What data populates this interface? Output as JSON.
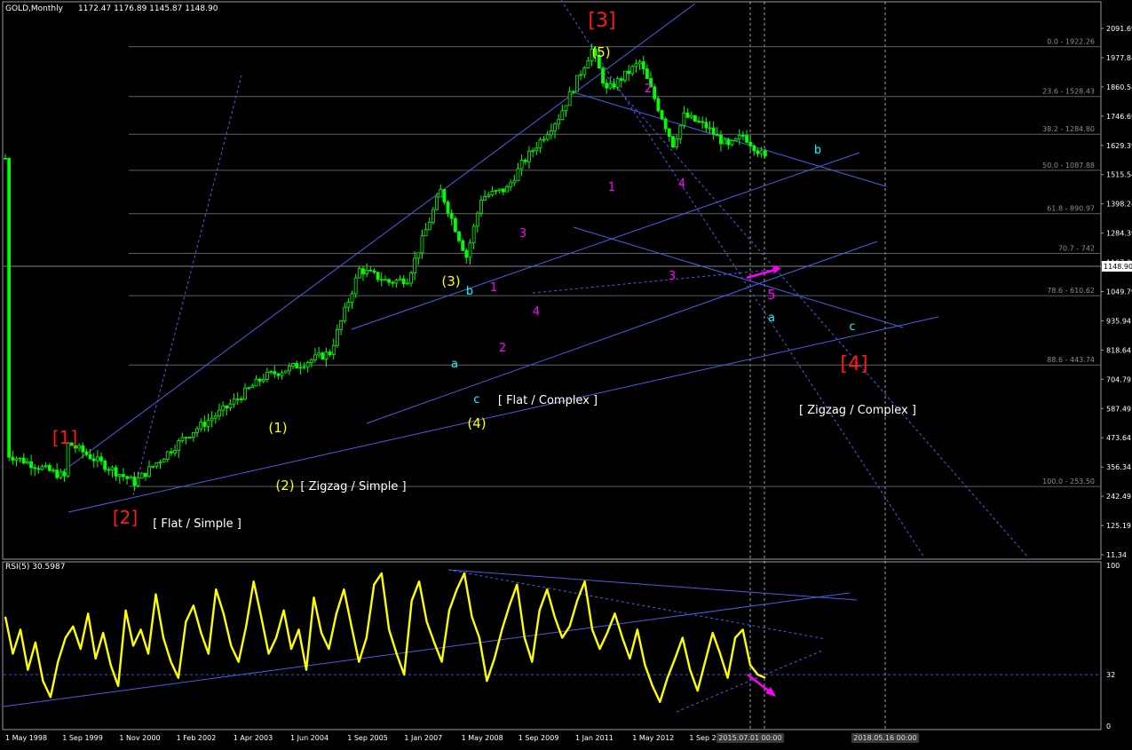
{
  "window": {
    "symbol_title": "GOLD,Monthly",
    "ohlc": "1172.47 1176.89 1145.87 1148.90"
  },
  "colors": {
    "background": "#000000",
    "candles": "#00ff00",
    "trendlines": "#4a5ee8",
    "fib_lines": "#5a6268",
    "rsi_line": "#ffff00",
    "wave_red": "#ff1a1a",
    "wave_yellow": "#ffff00",
    "wave_magenta": "#ff00ff",
    "wave_cyan": "#00ffff",
    "axis_text": "#ffffff"
  },
  "chart_data": [
    {
      "type": "candlestick",
      "title": "GOLD,Monthly",
      "y_scale": "log",
      "ylim": [
        11.34,
        2200
      ],
      "price_axis_ticks": [
        "2091.69",
        "1977.84",
        "1860.54",
        "1746.69",
        "1629.39",
        "1515.54",
        "1398.24",
        "1284.39",
        "1167.09",
        "1049.79",
        "935.94",
        "818.64",
        "704.79",
        "587.49",
        "473.64",
        "356.34",
        "242.49",
        "125.19",
        "11.34"
      ],
      "current_price_label": "1148.90",
      "time_axis_ticks": [
        "1 May 1998",
        "1 Sep 1999",
        "1 Nov 2000",
        "1 Feb 2002",
        "1 Apr 2003",
        "1 Jun 2004",
        "1 Sep 2005",
        "1 Jan 2007",
        "1 May 2008",
        "1 Sep 2009",
        "1 Jan 2011",
        "1 May 2012",
        "1 Sep 20"
      ],
      "time_axis_markers": [
        "2015.07.01 00:00",
        "2018.05.16 00:00"
      ],
      "price_path": [
        {
          "date": "1998.05",
          "price": 295
        },
        {
          "date": "1999.09",
          "price": 265
        },
        {
          "date": "1999.10",
          "price": 310
        },
        {
          "date": "2000.06",
          "price": 285
        },
        {
          "date": "2001.04",
          "price": 258
        },
        {
          "date": "2002.06",
          "price": 320
        },
        {
          "date": "2003.05",
          "price": 365
        },
        {
          "date": "2004.03",
          "price": 420
        },
        {
          "date": "2004.11",
          "price": 440
        },
        {
          "date": "2005.09",
          "price": 470
        },
        {
          "date": "2006.05",
          "price": 690
        },
        {
          "date": "2007.01",
          "price": 650
        },
        {
          "date": "2007.06",
          "price": 660
        },
        {
          "date": "2008.03",
          "price": 990
        },
        {
          "date": "2008.10",
          "price": 730
        },
        {
          "date": "2009.02",
          "price": 960
        },
        {
          "date": "2009.09",
          "price": 1000
        },
        {
          "date": "2010.01",
          "price": 1120
        },
        {
          "date": "2010.06",
          "price": 1250
        },
        {
          "date": "2010.11",
          "price": 1390
        },
        {
          "date": "2011.08",
          "price": 1900
        },
        {
          "date": "2011.12",
          "price": 1570
        },
        {
          "date": "2012.09",
          "price": 1790
        },
        {
          "date": "2013.06",
          "price": 1225
        },
        {
          "date": "2013.09",
          "price": 1400
        },
        {
          "date": "2014.03",
          "price": 1330
        },
        {
          "date": "2014.09",
          "price": 1210
        },
        {
          "date": "2015.01",
          "price": 1280
        },
        {
          "date": "2015.07",
          "price": 1150
        }
      ],
      "fibonacci_levels": [
        {
          "label": "0.0 - 1922.26",
          "price": 1922.26
        },
        {
          "label": "23.6 - 1528.43",
          "price": 1528.43
        },
        {
          "label": "38.2 - 1284.80",
          "price": 1284.8
        },
        {
          "label": "50.0 - 1087.88",
          "price": 1087.88
        },
        {
          "label": "61.8 - 890.97",
          "price": 890.97
        },
        {
          "label": "70.7 - 742",
          "price": 742
        },
        {
          "label": "78.6 - 610.62",
          "price": 610.62
        },
        {
          "label": "88.6 - 443.74",
          "price": 443.74
        },
        {
          "label": "100.0 - 253.50",
          "price": 253.5
        }
      ],
      "wave_labels": [
        {
          "text": "[1]",
          "color": "wave_red"
        },
        {
          "text": "[2]",
          "color": "wave_red"
        },
        {
          "text": "[ Flat / Simple ]",
          "color": "axis_text"
        },
        {
          "text": "(1)",
          "color": "wave_yellow"
        },
        {
          "text": "(2)",
          "color": "wave_yellow"
        },
        {
          "text": "[ Zigzag / Simple ]",
          "color": "axis_text"
        },
        {
          "text": "(3)",
          "color": "wave_yellow"
        },
        {
          "text": "(4)",
          "color": "wave_yellow"
        },
        {
          "text": "(5)",
          "color": "wave_yellow"
        },
        {
          "text": "[3]",
          "color": "wave_red"
        },
        {
          "text": "[4]",
          "color": "wave_red"
        },
        {
          "text": "[ Flat / Complex ]",
          "color": "axis_text"
        },
        {
          "text": "[ Zigzag / Complex ]",
          "color": "axis_text"
        },
        {
          "text": "a",
          "color": "wave_cyan"
        },
        {
          "text": "b",
          "color": "wave_cyan"
        },
        {
          "text": "c",
          "color": "wave_cyan"
        },
        {
          "text": "1",
          "color": "wave_magenta"
        },
        {
          "text": "2",
          "color": "wave_magenta"
        },
        {
          "text": "3",
          "color": "wave_magenta"
        },
        {
          "text": "4",
          "color": "wave_magenta"
        },
        {
          "text": "1",
          "color": "wave_magenta"
        },
        {
          "text": "2",
          "color": "wave_magenta"
        },
        {
          "text": "3",
          "color": "wave_magenta"
        },
        {
          "text": "4",
          "color": "wave_magenta"
        },
        {
          "text": "5",
          "color": "wave_magenta"
        },
        {
          "text": "a",
          "color": "wave_cyan"
        },
        {
          "text": "b",
          "color": "wave_cyan"
        },
        {
          "text": "c",
          "color": "wave_cyan"
        }
      ]
    },
    {
      "type": "line",
      "title": "RSI(5) 30.5987",
      "ylim": [
        0,
        100
      ],
      "y_ticks": [
        "100",
        "32",
        "0"
      ],
      "reference_level": 32,
      "last_value": 30.5987,
      "series": [
        {
          "name": "RSI(5)",
          "values": [
            68,
            45,
            60,
            35,
            52,
            28,
            18,
            40,
            55,
            62,
            48,
            70,
            42,
            58,
            38,
            25,
            72,
            50,
            60,
            45,
            82,
            55,
            40,
            30,
            65,
            75,
            58,
            45,
            85,
            70,
            50,
            40,
            62,
            90,
            68,
            45,
            55,
            72,
            48,
            60,
            35,
            80,
            58,
            48,
            70,
            85,
            62,
            40,
            55,
            88,
            95,
            60,
            45,
            32,
            78,
            90,
            65,
            52,
            40,
            72,
            85,
            95,
            68,
            55,
            28,
            42,
            60,
            75,
            88,
            55,
            40,
            72,
            85,
            68,
            55,
            62,
            78,
            90,
            60,
            48,
            58,
            70,
            55,
            42,
            60,
            38,
            25,
            15,
            30,
            42,
            55,
            35,
            22,
            40,
            58,
            45,
            30,
            55,
            60,
            38,
            32,
            30
          ]
        }
      ]
    }
  ]
}
